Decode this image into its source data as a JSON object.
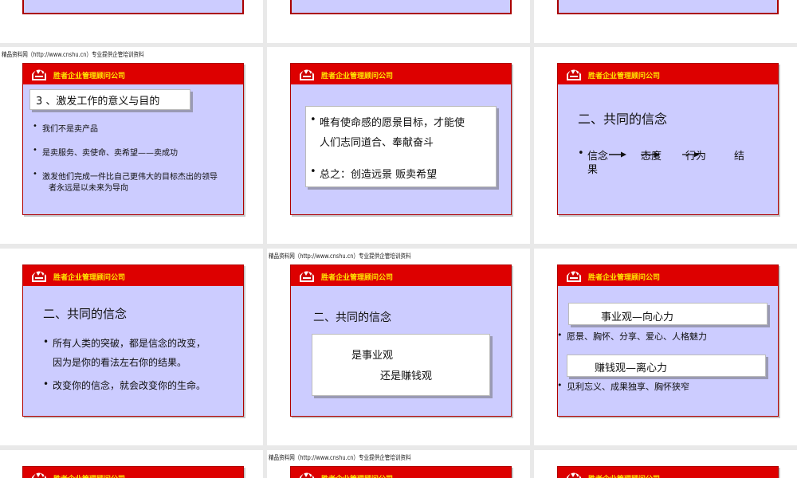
{
  "watermark": "精品资料网（http://www.cnshu.cn）专业提供企管培训资料",
  "company": "胜者企业管理顾问公司",
  "slide1": {
    "title": "3 、激发工作的意义与目的",
    "bullets": [
      "我们不是卖产品",
      "是卖服务、卖使命、卖希望——卖成功"
    ],
    "bullet3_line1": "激发他们完成一件比自己更伟大的目标杰出的领导",
    "bullet3_line2": "者永远是以未来为导向"
  },
  "slide2": {
    "b1_line1": "唯有使命感的愿景目标，才能使",
    "b1_line2": "人们志同道合、奉献奋斗",
    "b2": "总之：创造远景    贩卖希望"
  },
  "slide3": {
    "title": "二、共同的信念",
    "w1": "信念",
    "w2": "态度",
    "w3": "行为",
    "w4": "结",
    "w5": "果"
  },
  "slide4": {
    "title": "二、共同的信念",
    "b1_line1": "所有人类的突破，都是信念的改变，",
    "b1_line2": "因为是你的看法左右你的结果。",
    "b2": "改变你的信念，就会改变你的生命。"
  },
  "slide5": {
    "title": "二、共同的信念",
    "box_line1": "是事业观",
    "box_line2": "还是赚钱观"
  },
  "slide6": {
    "box1": "事业观—向心力",
    "b1": "愿景、胸怀、分享、爱心、人格魅力",
    "box2": "赚钱观—离心力",
    "b2": "见利忘义、成果独享、胸怀狭窄"
  }
}
